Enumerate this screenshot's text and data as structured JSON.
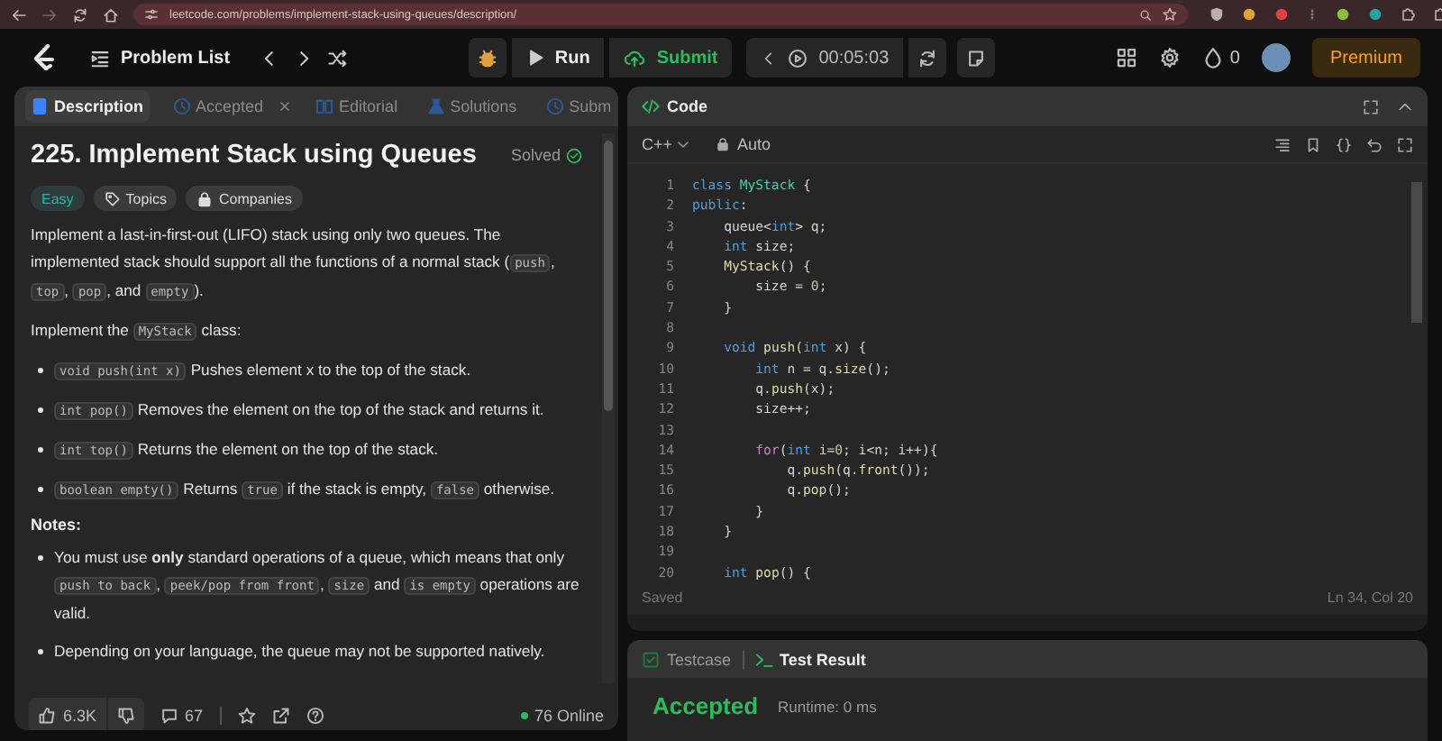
{
  "browser": {
    "url": "leetcode.com/problems/implement-stack-using-queues/description/"
  },
  "nav": {
    "problem_list": "Problem List",
    "run": "Run",
    "submit": "Submit",
    "timer": "00:05:03",
    "streak": "0",
    "premium": "Premium"
  },
  "description_tabs": [
    {
      "label": "Description",
      "selected": true,
      "closable": false
    },
    {
      "label": "Accepted",
      "selected": false,
      "closable": true
    },
    {
      "label": "Editorial",
      "selected": false,
      "closable": false
    },
    {
      "label": "Solutions",
      "selected": false,
      "closable": false
    },
    {
      "label": "Subm",
      "selected": false,
      "closable": false
    }
  ],
  "problem": {
    "title": "225. Implement Stack using Queues",
    "status": "Solved",
    "tags": [
      {
        "label": "Easy",
        "kind": "difficulty"
      },
      {
        "label": "Topics",
        "kind": "topics"
      },
      {
        "label": "Companies",
        "kind": "companies"
      }
    ],
    "content": [
      {
        "kind": "paragraph",
        "parts": [
          {
            "kind": "text",
            "text": "Implement a last-in-first-out (LIFO) stack using only two queues. The implemented stack should support all the functions of a normal stack ("
          },
          {
            "kind": "code",
            "text": "push"
          },
          {
            "kind": "text",
            "text": ", "
          },
          {
            "kind": "code",
            "text": "top"
          },
          {
            "kind": "text",
            "text": ", "
          },
          {
            "kind": "code",
            "text": "pop"
          },
          {
            "kind": "text",
            "text": ", and "
          },
          {
            "kind": "code",
            "text": "empty"
          },
          {
            "kind": "text",
            "text": ")."
          }
        ]
      },
      {
        "kind": "paragraph",
        "parts": [
          {
            "kind": "text",
            "text": "Implement the "
          },
          {
            "kind": "code",
            "text": "MyStack"
          },
          {
            "kind": "text",
            "text": " class:"
          }
        ]
      },
      {
        "kind": "list",
        "items": [
          [
            {
              "kind": "code",
              "text": "void push(int x)"
            },
            {
              "kind": "text",
              "text": " Pushes element x to the top of the stack."
            }
          ],
          [
            {
              "kind": "code",
              "text": "int pop()"
            },
            {
              "kind": "text",
              "text": " Removes the element on the top of the stack and returns it."
            }
          ],
          [
            {
              "kind": "code",
              "text": "int top()"
            },
            {
              "kind": "text",
              "text": " Returns the element on the top of the stack."
            }
          ],
          [
            {
              "kind": "code",
              "text": "boolean empty()"
            },
            {
              "kind": "text",
              "text": " Returns "
            },
            {
              "kind": "code",
              "text": "true"
            },
            {
              "kind": "text",
              "text": " if the stack is empty, "
            },
            {
              "kind": "code",
              "text": "false"
            },
            {
              "kind": "text",
              "text": " otherwise."
            }
          ]
        ]
      },
      {
        "kind": "heading",
        "text": "Notes:"
      },
      {
        "kind": "list",
        "items": [
          [
            {
              "kind": "text",
              "text": "You must use "
            },
            {
              "kind": "bold",
              "text": "only"
            },
            {
              "kind": "text",
              "text": " standard operations of a queue, which means that only "
            },
            {
              "kind": "code",
              "text": "push to back"
            },
            {
              "kind": "text",
              "text": ", "
            },
            {
              "kind": "code",
              "text": "peek/pop from front"
            },
            {
              "kind": "text",
              "text": ", "
            },
            {
              "kind": "code",
              "text": "size"
            },
            {
              "kind": "text",
              "text": " and "
            },
            {
              "kind": "code",
              "text": "is empty"
            },
            {
              "kind": "text",
              "text": " operations are valid."
            }
          ],
          [
            {
              "kind": "text",
              "text": "Depending on your language, the queue may not be supported natively."
            }
          ]
        ]
      }
    ]
  },
  "footer": {
    "likes": "6.3K",
    "comments": "67",
    "online": "76 Online"
  },
  "editor": {
    "title": "Code",
    "language": "C++",
    "mode": "Auto",
    "lines": [
      {
        "n": "1",
        "tokens": [
          {
            "kind": "keyword",
            "text": "class"
          },
          {
            "kind": "type",
            "text": " MyStack"
          },
          {
            "kind": "plain",
            "text": " {"
          }
        ]
      },
      {
        "n": "2",
        "tokens": [
          {
            "kind": "keyword",
            "text": "public"
          },
          {
            "kind": "plain",
            "text": ":"
          }
        ]
      },
      {
        "n": "3",
        "tokens": [
          {
            "kind": "plain",
            "text": "    queue<"
          },
          {
            "kind": "keyword",
            "text": "int"
          },
          {
            "kind": "plain",
            "text": "> q;"
          }
        ]
      },
      {
        "n": "4",
        "tokens": [
          {
            "kind": "keyword",
            "text": "    int"
          },
          {
            "kind": "plain",
            "text": " size;"
          }
        ]
      },
      {
        "n": "5",
        "tokens": [
          {
            "kind": "function",
            "text": "    MyStack"
          },
          {
            "kind": "plain",
            "text": "() {"
          }
        ]
      },
      {
        "n": "6",
        "tokens": [
          {
            "kind": "plain",
            "text": "        size = "
          },
          {
            "kind": "number",
            "text": "0"
          },
          {
            "kind": "plain",
            "text": ";"
          }
        ]
      },
      {
        "n": "7",
        "tokens": [
          {
            "kind": "plain",
            "text": "    }"
          }
        ]
      },
      {
        "n": "8"
      },
      {
        "n": "9",
        "tokens": [
          {
            "kind": "keyword",
            "text": "    void"
          },
          {
            "kind": "function",
            "text": " push"
          },
          {
            "kind": "plain",
            "text": "("
          },
          {
            "kind": "keyword",
            "text": "int"
          },
          {
            "kind": "plain",
            "text": " x) {"
          }
        ]
      },
      {
        "n": "10",
        "tokens": [
          {
            "kind": "keyword",
            "text": "        int"
          },
          {
            "kind": "plain",
            "text": " n = q."
          },
          {
            "kind": "function",
            "text": "size"
          },
          {
            "kind": "plain",
            "text": "();"
          }
        ]
      },
      {
        "n": "11",
        "tokens": [
          {
            "kind": "plain",
            "text": "        q."
          },
          {
            "kind": "function",
            "text": "push"
          },
          {
            "kind": "plain",
            "text": "(x);"
          }
        ]
      },
      {
        "n": "12",
        "tokens": [
          {
            "kind": "plain",
            "text": "        size++;"
          }
        ]
      },
      {
        "n": "13"
      },
      {
        "n": "14",
        "tokens": [
          {
            "kind": "control",
            "text": "        for"
          },
          {
            "kind": "plain",
            "text": "("
          },
          {
            "kind": "keyword",
            "text": "int"
          },
          {
            "kind": "plain",
            "text": " i="
          },
          {
            "kind": "number",
            "text": "0"
          },
          {
            "kind": "plain",
            "text": "; i<n; i++){"
          }
        ]
      },
      {
        "n": "15",
        "tokens": [
          {
            "kind": "plain",
            "text": "            q."
          },
          {
            "kind": "function",
            "text": "push"
          },
          {
            "kind": "plain",
            "text": "(q."
          },
          {
            "kind": "function",
            "text": "front"
          },
          {
            "kind": "plain",
            "text": "());"
          }
        ]
      },
      {
        "n": "16",
        "tokens": [
          {
            "kind": "plain",
            "text": "            q."
          },
          {
            "kind": "function",
            "text": "pop"
          },
          {
            "kind": "plain",
            "text": "();"
          }
        ]
      },
      {
        "n": "17",
        "tokens": [
          {
            "kind": "plain",
            "text": "        }"
          }
        ]
      },
      {
        "n": "18",
        "tokens": [
          {
            "kind": "plain",
            "text": "    }"
          }
        ]
      },
      {
        "n": "19"
      },
      {
        "n": "20",
        "tokens": [
          {
            "kind": "keyword",
            "text": "    int"
          },
          {
            "kind": "function",
            "text": " pop"
          },
          {
            "kind": "plain",
            "text": "() {"
          }
        ]
      }
    ],
    "save_status": "Saved",
    "cursor": "Ln 34, Col 20"
  },
  "test_panel": {
    "tabs": [
      {
        "label": "Testcase",
        "selected": false
      },
      {
        "label": "Test Result",
        "selected": true
      }
    ],
    "result": "Accepted",
    "runtime": "Runtime: 0 ms"
  }
}
